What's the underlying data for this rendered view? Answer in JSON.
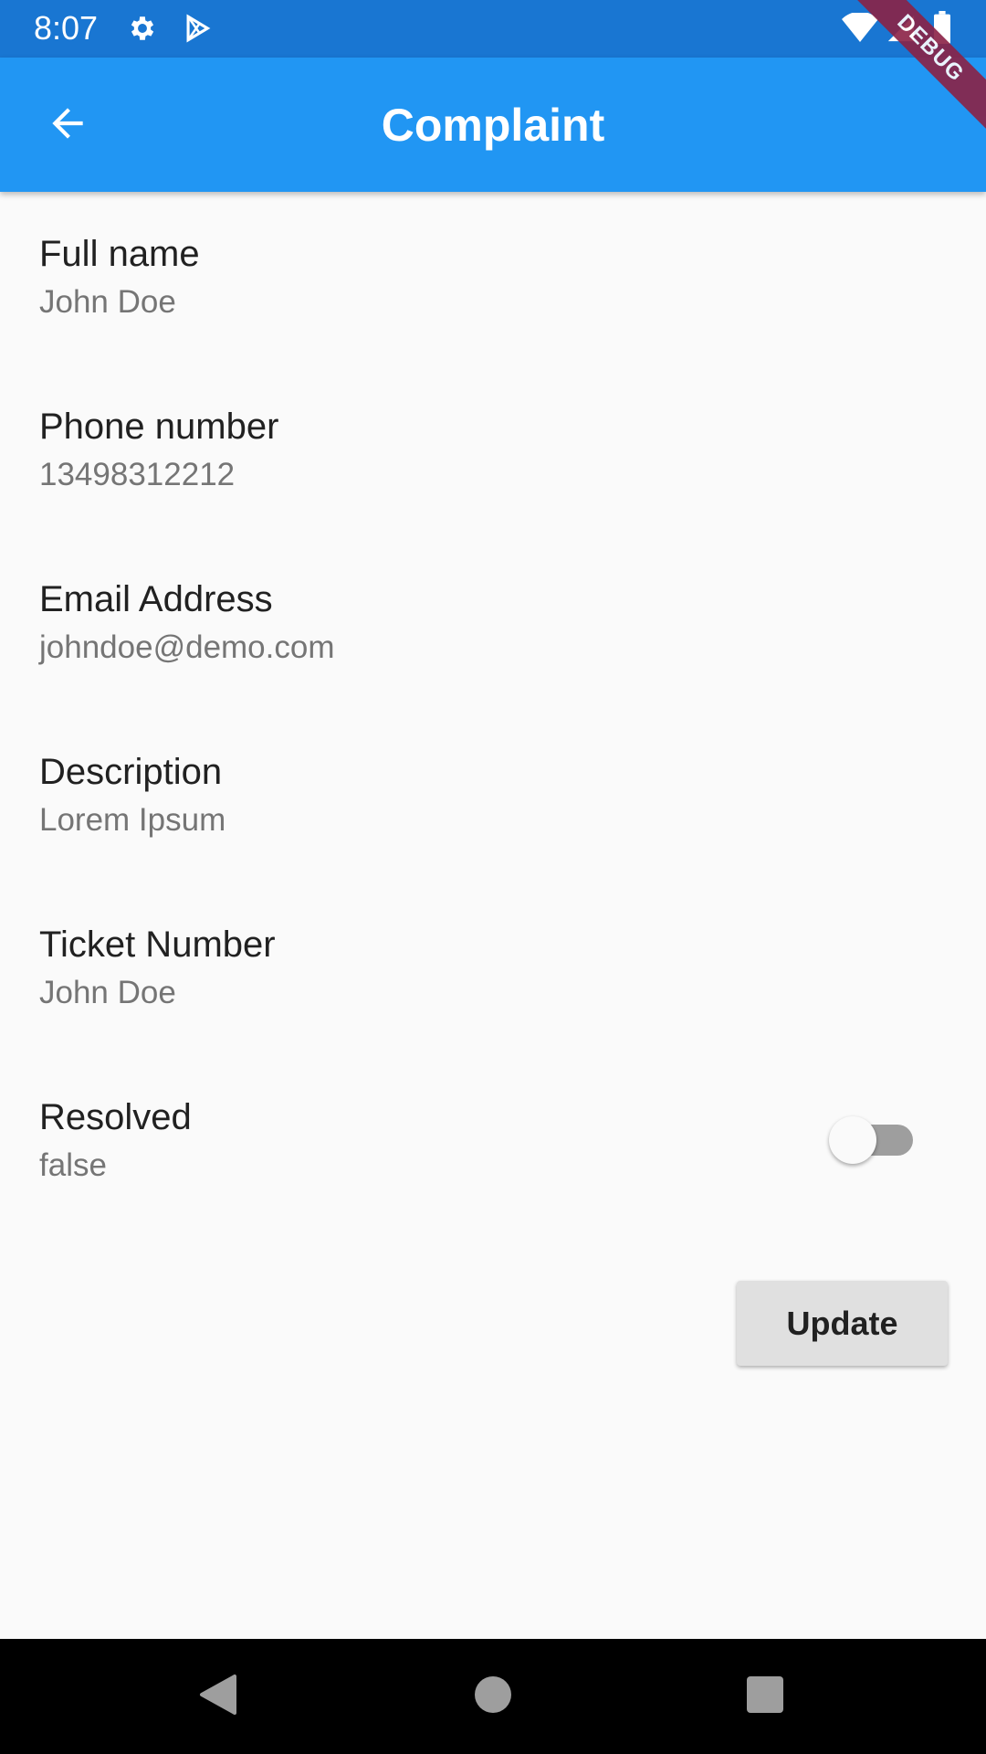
{
  "status_bar": {
    "time": "8:07",
    "icons": [
      "gear-icon",
      "play-store-icon",
      "wifi-icon",
      "signal-icon",
      "battery-icon"
    ],
    "background": "#1976d2"
  },
  "app_bar": {
    "title": "Complaint",
    "back_icon": "arrow-back-icon",
    "background": "#2196f3"
  },
  "debug_banner": {
    "label": "DEBUG"
  },
  "fields": [
    {
      "label": "Full name",
      "value": "John Doe"
    },
    {
      "label": "Phone number",
      "value": "13498312212"
    },
    {
      "label": "Email Address",
      "value": "johndoe@demo.com"
    },
    {
      "label": "Description",
      "value": "Lorem Ipsum"
    },
    {
      "label": "Ticket Number",
      "value": "John Doe"
    },
    {
      "label": "Resolved",
      "value": "false"
    }
  ],
  "resolved_switch": {
    "on": false
  },
  "update_button": {
    "label": "Update"
  },
  "nav_bar": {
    "icons": [
      "back-triangle-icon",
      "home-circle-icon",
      "recents-square-icon"
    ]
  }
}
